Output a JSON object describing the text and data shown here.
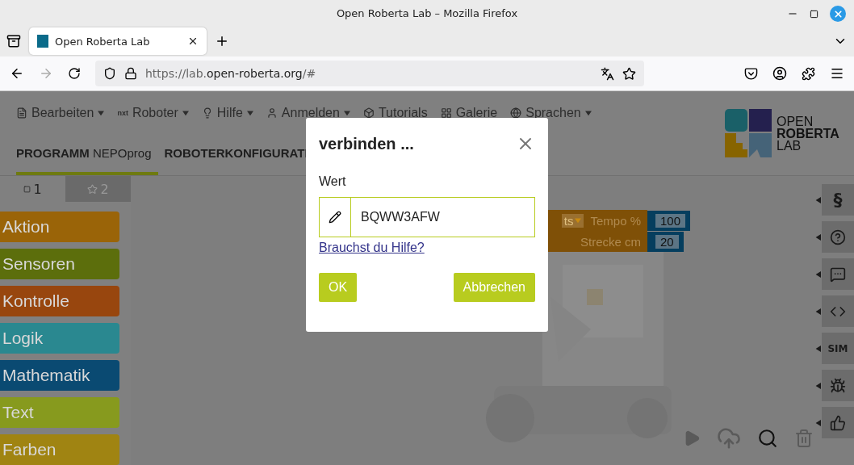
{
  "window": {
    "title": "Open Roberta Lab – Mozilla Firefox"
  },
  "browser": {
    "tabs": [
      {
        "label": "Open Roberta Lab",
        "selected": true
      }
    ],
    "url": {
      "scheme": "https://lab.",
      "domain": "open-roberta.org",
      "rest": "/#"
    }
  },
  "app": {
    "menu": [
      {
        "kind": "edit",
        "label": "Bearbeiten"
      },
      {
        "kind": "nxt",
        "label": "Roboter",
        "nxt": "nxt"
      },
      {
        "kind": "bulb",
        "label": "Hilfe"
      },
      {
        "kind": "user",
        "label": "Anmelden"
      },
      {
        "kind": "cube",
        "label": "Tutorials"
      },
      {
        "kind": "grid",
        "label": "Galerie"
      },
      {
        "kind": "globe",
        "label": "Sprachen"
      }
    ],
    "logo": [
      "OPEN",
      "ROBERTA",
      "LAB"
    ],
    "tabs": [
      {
        "label": "**PROGRAMM** NEPOprog",
        "selected": true
      },
      {
        "label": "ROBOTERKONFIGURATI",
        "selected": false
      }
    ],
    "toolbox_tabs": [
      {
        "kind": "square",
        "label": "1",
        "selected": true
      },
      {
        "kind": "star",
        "label": "2",
        "selected": false
      }
    ],
    "categories": [
      {
        "label": "Aktion",
        "color": "#9a6408"
      },
      {
        "label": "Sensoren",
        "color": "#5c6e0c"
      },
      {
        "label": "Kontrolle",
        "color": "#98460e"
      },
      {
        "label": "Logik",
        "color": "#2a8890"
      },
      {
        "label": "Mathematik",
        "color": "#0a4a72"
      },
      {
        "label": "Text",
        "color": "#879a1e"
      },
      {
        "label": "Farben",
        "color": "#a08412"
      }
    ],
    "block": {
      "dropdown": "ts",
      "rows": [
        {
          "label": "Tempo %",
          "value": "100"
        },
        {
          "label": "Strecke cm",
          "value": "20"
        }
      ]
    },
    "side_buttons": [
      {
        "kind": "variable",
        "label": "§"
      },
      {
        "kind": "help"
      },
      {
        "kind": "comment"
      },
      {
        "kind": "code"
      },
      {
        "kind": "sim",
        "label": "SIM"
      },
      {
        "kind": "debug"
      },
      {
        "kind": "feedback"
      }
    ]
  },
  "dialog": {
    "title": "verbinden ...",
    "label": "Wert",
    "value": "BQWW3AFW",
    "link": "Brauchst du Hilfe?",
    "buttons": [
      "OK",
      "Abbrechen"
    ]
  }
}
